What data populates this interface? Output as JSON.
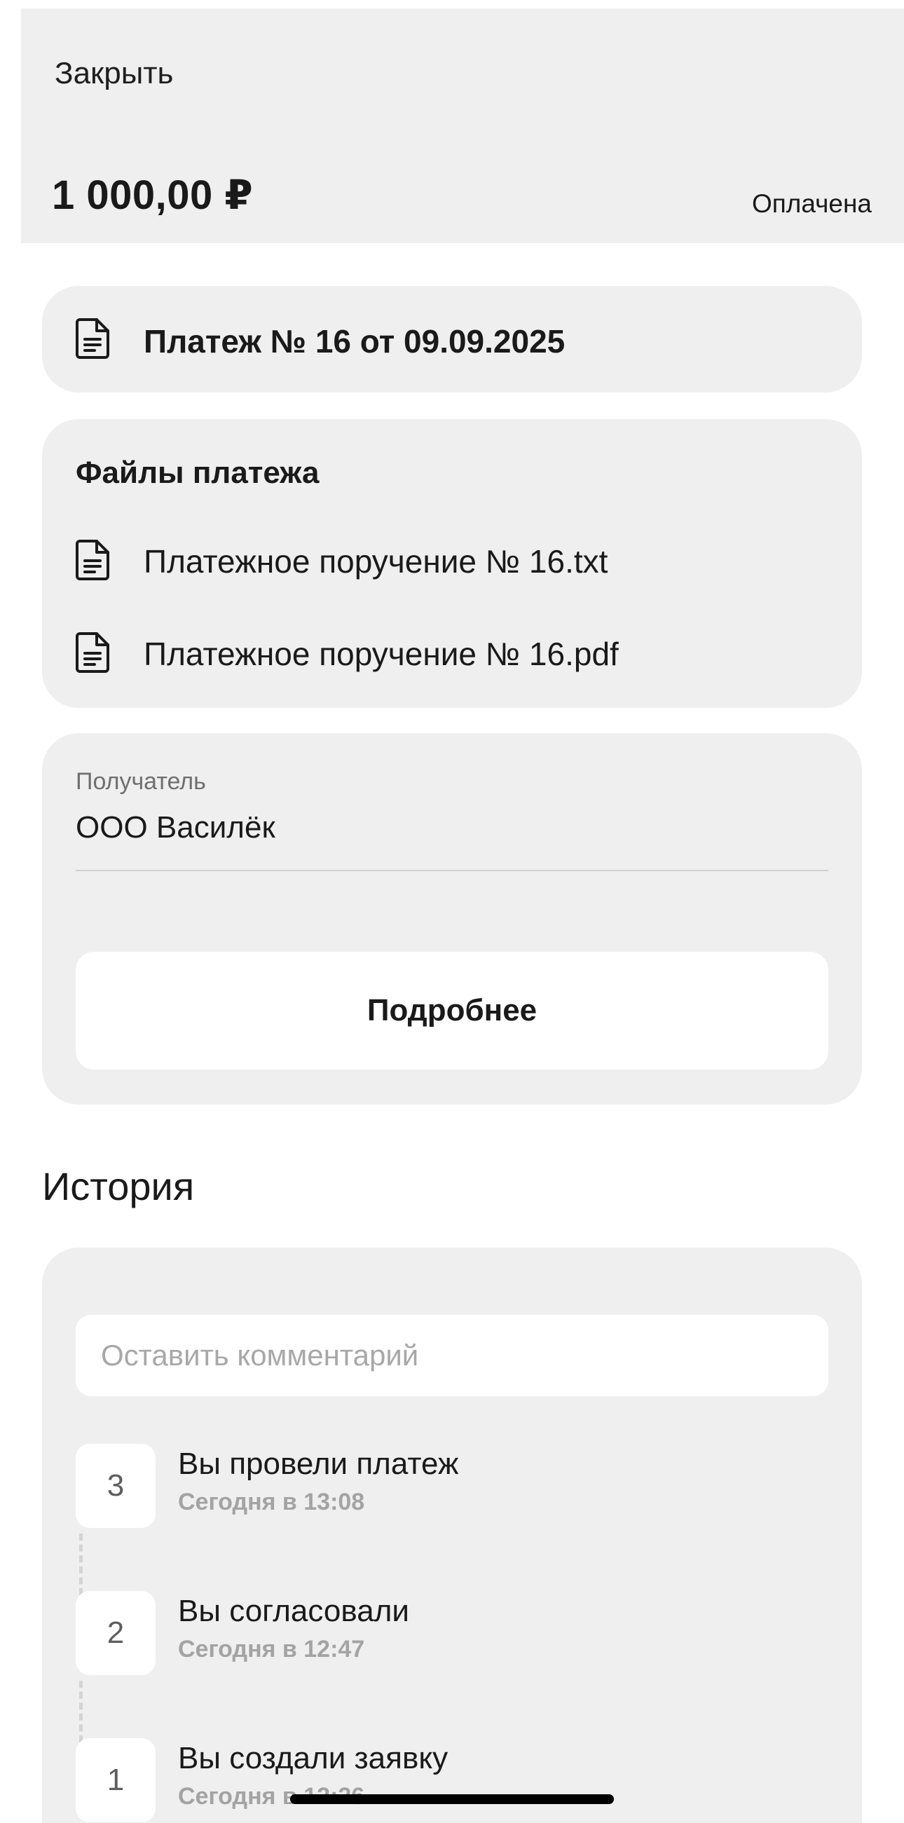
{
  "header": {
    "close_label": "Закрыть",
    "amount": "1 000,00 ₽",
    "status": "Оплачена"
  },
  "payment": {
    "icon": "document-icon",
    "title": "Платеж № 16 от 09.09.2025"
  },
  "files": {
    "title": "Файлы платежа",
    "items": [
      {
        "icon": "document-icon",
        "name": "Платежное поручение № 16.txt"
      },
      {
        "icon": "document-icon",
        "name": "Платежное поручение № 16.pdf"
      }
    ]
  },
  "recipient": {
    "label": "Получатель",
    "value": "ООО Василёк",
    "details_label": "Подробнее"
  },
  "history": {
    "heading": "История",
    "comment_placeholder": "Оставить комментарий",
    "events": [
      {
        "number": "3",
        "title": "Вы провели платеж",
        "time": "Сегодня в 13:08"
      },
      {
        "number": "2",
        "title": "Вы согласовали",
        "time": "Сегодня в 12:47"
      },
      {
        "number": "1",
        "title": "Вы создали заявку",
        "time": "Сегодня в 12:26"
      }
    ]
  },
  "colors": {
    "card_bg": "#efefef",
    "page_bg": "#ffffff",
    "text_primary": "#1a1a1a",
    "text_muted": "#a3a3a3"
  }
}
